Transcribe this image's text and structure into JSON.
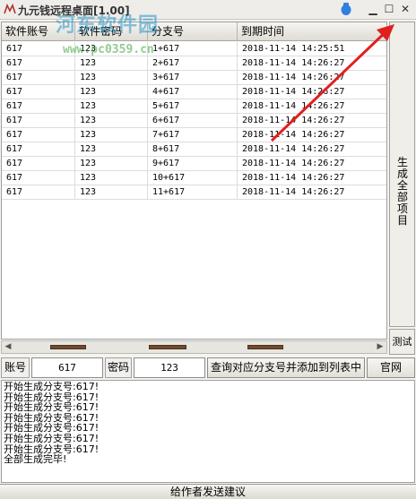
{
  "window": {
    "title": "九元钱远程桌面[1.00]",
    "buttons": {
      "minimize": "▁",
      "maximize": "☐",
      "close": "✕"
    }
  },
  "watermark": {
    "text": "河东软件园",
    "url": "www.pc0359.cn"
  },
  "table": {
    "columns": [
      "软件账号",
      "软件密码",
      "分支号",
      "到期时间"
    ],
    "rows": [
      [
        "617",
        "123",
        "1+617",
        "2018-11-14  14:25:51"
      ],
      [
        "617",
        "123",
        "2+617",
        "2018-11-14  14:26:27"
      ],
      [
        "617",
        "123",
        "3+617",
        "2018-11-14  14:26:27"
      ],
      [
        "617",
        "123",
        "4+617",
        "2018-11-14  14:26:27"
      ],
      [
        "617",
        "123",
        "5+617",
        "2018-11-14  14:26:27"
      ],
      [
        "617",
        "123",
        "6+617",
        "2018-11-14  14:26:27"
      ],
      [
        "617",
        "123",
        "7+617",
        "2018-11-14  14:26:27"
      ],
      [
        "617",
        "123",
        "8+617",
        "2018-11-14  14:26:27"
      ],
      [
        "617",
        "123",
        "9+617",
        "2018-11-14  14:26:27"
      ],
      [
        "617",
        "123",
        "10+617",
        "2018-11-14  14:26:27"
      ],
      [
        "617",
        "123",
        "11+617",
        "2018-11-14  14:26:27"
      ]
    ]
  },
  "side": {
    "generate_label": "生成全部项目",
    "test_label": "测试"
  },
  "toolbar": {
    "account_label": "账号",
    "account_value": "617",
    "password_label": "密码",
    "password_value": "123",
    "query_button": "查询对应分支号并添加到列表中",
    "official_button": "官网"
  },
  "log": {
    "lines": [
      "开始生成分支号:617!",
      "开始生成分支号:617!",
      "开始生成分支号:617!",
      "开始生成分支号:617!",
      "开始生成分支号:617!",
      "开始生成分支号:617!",
      "开始生成分支号:617!",
      "全部生成完毕!"
    ]
  },
  "feedback_button": "给作者发送建议",
  "colors": {
    "arrow": "#e02020",
    "scroll_thumb": "#6e4a2c"
  }
}
